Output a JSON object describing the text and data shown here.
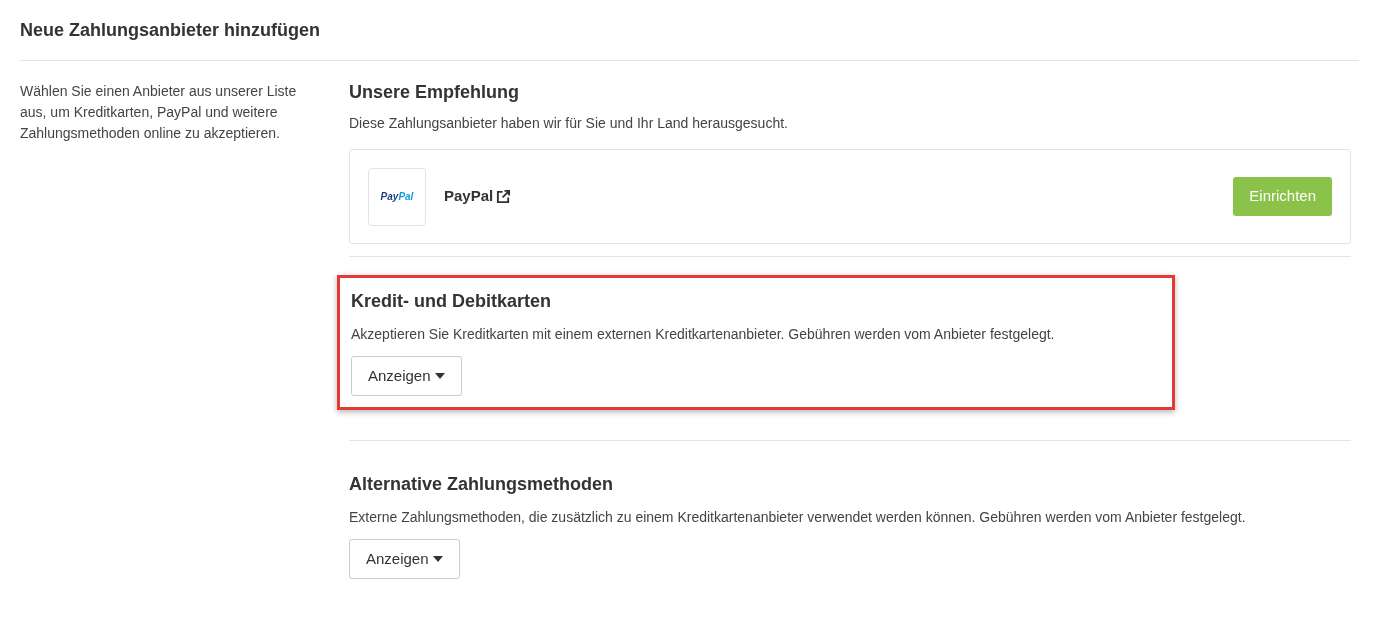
{
  "page_title": "Neue Zahlungsanbieter hinzufügen",
  "intro": "Wählen Sie einen Anbieter aus unserer Liste aus, um Kreditkarten, PayPal und weitere Zahlungsmethoden online zu akzeptieren.",
  "recommendation": {
    "title": "Unsere Empfehlung",
    "description": "Diese Zahlungsanbieter haben wir für Sie und Ihr Land herausgesucht.",
    "providers": [
      {
        "logo_text_1": "Pay",
        "logo_text_2": "Pal",
        "name": "PayPal",
        "button": "Einrichten"
      }
    ]
  },
  "sections": [
    {
      "title": "Kredit- und Debitkarten",
      "description": "Akzeptieren Sie Kreditkarten mit einem externen Kreditkartenanbieter. Gebühren werden vom Anbieter festgelegt.",
      "button": "Anzeigen",
      "highlighted": true
    },
    {
      "title": "Alternative Zahlungsmethoden",
      "description": "Externe Zahlungsmethoden, die zusätzlich zu einem Kreditkartenanbieter verwendet werden können. Gebühren werden vom Anbieter festgelegt.",
      "button": "Anzeigen",
      "highlighted": false
    }
  ]
}
